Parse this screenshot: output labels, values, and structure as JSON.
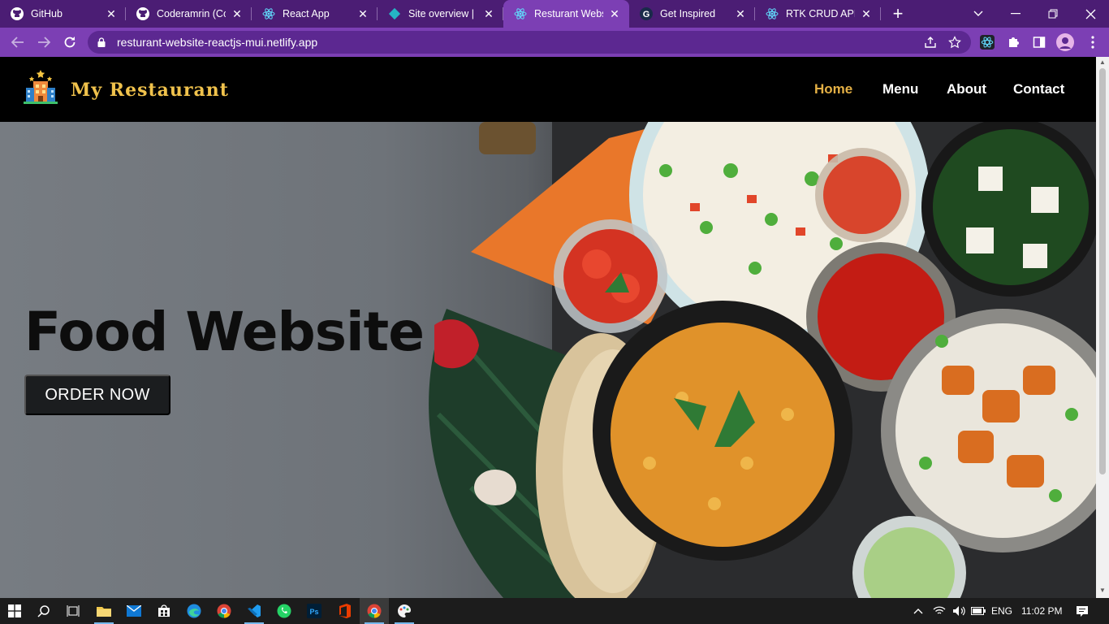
{
  "browser": {
    "tabs": [
      {
        "label": "GitHub",
        "icon": "github-icon",
        "active": false
      },
      {
        "label": "Coderamrin (Coderamrin)",
        "icon": "github-icon",
        "active": false
      },
      {
        "label": "React App",
        "icon": "react-icon",
        "active": false
      },
      {
        "label": "Site overview | in",
        "icon": "netlify-icon",
        "active": false
      },
      {
        "label": "Resturant Website",
        "icon": "react-icon",
        "active": true
      },
      {
        "label": "Get Inspired",
        "icon": "g-icon",
        "active": false
      },
      {
        "label": "RTK CRUD APP",
        "icon": "react-icon",
        "active": false
      }
    ],
    "new_tab": "+",
    "url": "resturant-website-reactjs-mui.netlify.app"
  },
  "site": {
    "brand": "My Restaurant",
    "nav": [
      {
        "label": "Home",
        "active": true
      },
      {
        "label": "Menu",
        "active": false
      },
      {
        "label": "About",
        "active": false
      },
      {
        "label": "Contact",
        "active": false
      }
    ],
    "hero_title": "Food Website",
    "cta_label": "ORDER NOW",
    "colors": {
      "accent": "#e4b045",
      "brand": "#f0c24c",
      "header_bg": "#000000",
      "browser": "#7c3fb4"
    }
  },
  "taskbar": {
    "language": "ENG",
    "time": "11:02 PM",
    "apps": [
      "start-icon",
      "search-icon",
      "task-view-icon",
      "file-explorer-icon",
      "mail-icon",
      "store-icon",
      "edge-icon",
      "chrome-icon",
      "vscode-icon",
      "whatsapp-icon",
      "photoshop-icon",
      "office-icon",
      "chrome-active-icon",
      "paint-icon"
    ]
  }
}
